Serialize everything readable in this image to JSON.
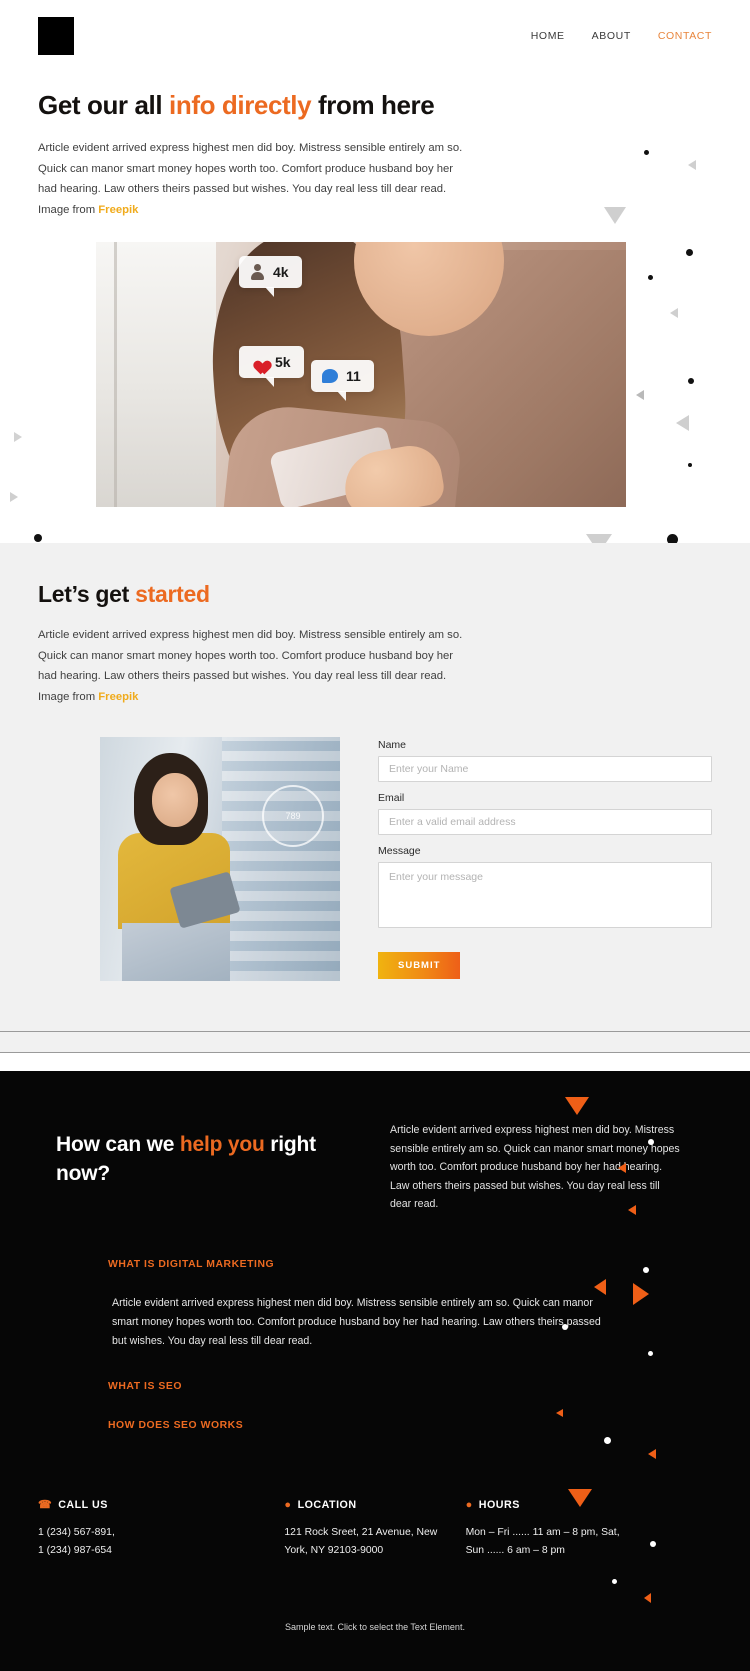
{
  "header": {
    "logo": "logo-mark",
    "nav": [
      {
        "label": "HOME",
        "active": false
      },
      {
        "label": "ABOUT",
        "active": false
      },
      {
        "label": "CONTACT",
        "active": true
      }
    ]
  },
  "hero": {
    "title_part1": "Get our all ",
    "title_accent": "info directly",
    "title_part2": " from here",
    "paragraph": "Article evident arrived express highest men did boy. Mistress sensible entirely am so. Quick can manor smart money hopes worth too. Comfort produce husband boy her had hearing. Law others theirs passed but wishes. You day real less till dear read. Image from ",
    "paragraph_link": "Freepik",
    "badges": [
      {
        "icon": "person-icon",
        "value": "4k"
      },
      {
        "icon": "heart-icon",
        "value": "5k"
      },
      {
        "icon": "comment-icon",
        "value": "11"
      }
    ]
  },
  "started": {
    "title_part1": "Let’s get ",
    "title_accent": "started",
    "paragraph": "Article evident arrived express highest men did boy. Mistress sensible entirely am so. Quick can manor smart money hopes worth too. Comfort produce husband boy her had hearing. Law others theirs passed but wishes. You day real less till dear read. Image from ",
    "paragraph_link": "Freepik",
    "form": {
      "name_label": "Name",
      "name_placeholder": "Enter your Name",
      "email_label": "Email",
      "email_placeholder": "Enter a valid email address",
      "message_label": "Message",
      "message_placeholder": "Enter your message",
      "submit_label": "SUBMIT"
    }
  },
  "dark": {
    "title_part1": "How can we ",
    "title_accent": "help you",
    "title_part2": " right now?",
    "paragraph": "Article evident arrived express highest men did boy. Mistress sensible entirely am so. Quick can manor smart money hopes worth too. Comfort produce husband boy her had hearing. Law others theirs passed but wishes. You day real less till dear read.",
    "accordion": [
      {
        "title": "WHAT IS DIGITAL MARKETING",
        "body": "Article evident arrived express highest men did boy. Mistress sensible entirely am so. Quick can manor smart money hopes worth too. Comfort produce husband boy her had hearing. Law others theirs passed but wishes. You day real less till dear read.",
        "open": true
      },
      {
        "title": "WHAT IS SEO",
        "body": "",
        "open": false
      },
      {
        "title": "HOW DOES SEO WORKS",
        "body": "",
        "open": false
      }
    ],
    "contacts": [
      {
        "icon": "phone-icon",
        "heading": "CALL US",
        "line1": "1 (234) 567-891,",
        "line2": "1 (234) 987-654"
      },
      {
        "icon": "location-pin-icon",
        "heading": "LOCATION",
        "line1": "121 Rock Sreet, 21 Avenue, New",
        "line2": "York, NY 92103-9000"
      },
      {
        "icon": "clock-icon",
        "heading": "HOURS",
        "line1": "Mon – Fri ...... 11 am – 8 pm, Sat,",
        "line2": "Sun  ...... 6 am – 8 pm"
      }
    ],
    "footer_note": "Sample text. Click to select the Text Element."
  },
  "colors": {
    "accent_orange": "#ec6a21",
    "nav_active": "#e8853c",
    "link_yellow": "#f0ab1c",
    "dark_bg": "#060606",
    "light_bg": "#f1f1f1"
  }
}
